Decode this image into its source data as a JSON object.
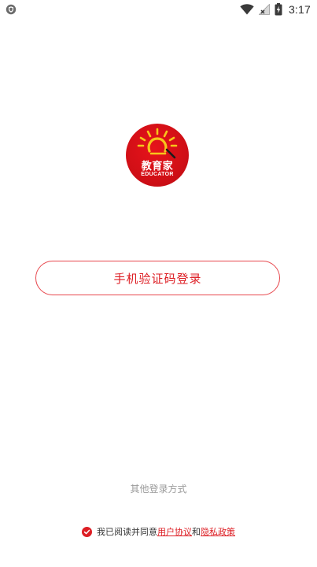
{
  "status_bar": {
    "time": "3:17"
  },
  "logo": {
    "title": "教育家",
    "subtitle": "EDUCATOR"
  },
  "login": {
    "phone_button": "手机验证码登录",
    "other_methods": "其他登录方式"
  },
  "agreement": {
    "prefix": "我已阅读并同意",
    "user_agreement": "用户协议",
    "conjunction": "和",
    "privacy_policy": "隐私政策"
  },
  "colors": {
    "brand_red": "#dd1e24",
    "logo_red": "#d10f16",
    "sun_yellow": "#f7c51b",
    "muted_text": "#9a9a9a"
  },
  "icons": {
    "status_left": "shield-icon",
    "wifi": "wifi-icon",
    "signal": "signal-icon",
    "battery": "battery-charging-icon",
    "agreement_check": "check-circle-icon"
  }
}
